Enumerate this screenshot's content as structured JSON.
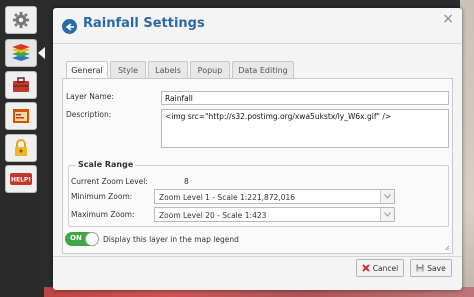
{
  "toolbar": {
    "tools": [
      {
        "icon": "gear-icon"
      },
      {
        "icon": "layers-icon"
      },
      {
        "icon": "toolbox-icon"
      },
      {
        "icon": "map-window-icon"
      },
      {
        "icon": "lock-icon"
      },
      {
        "icon": "help-icon",
        "label": "HELP!"
      }
    ]
  },
  "panel": {
    "title": "Rainfall Settings",
    "tabs": [
      "General",
      "Style",
      "Labels",
      "Popup",
      "Data Editing"
    ],
    "layer_name_label": "Layer Name:",
    "layer_name_value": "Rainfall",
    "description_label": "Description:",
    "description_value": "<img src=\"http://s32.postimg.org/xwa5ukstx/ly_W6x.gif\" />",
    "scale_range": {
      "legend": "Scale Range",
      "current_zoom_label": "Current Zoom Level:",
      "current_zoom_value": "8",
      "min_zoom_label": "Minimum Zoom:",
      "min_zoom_value": "Zoom Level 1 - Scale 1:221,872,016",
      "max_zoom_label": "Maximum Zoom:",
      "max_zoom_value": "Zoom Level 20 - Scale 1:423"
    },
    "legend_toggle": {
      "state": "ON",
      "label": "Display this layer in the map legend"
    },
    "cancel_label": "Cancel",
    "save_label": "Save"
  },
  "colors": {
    "accent": "#2b6aa8",
    "toggle_on": "#3ea644",
    "cancel_x": "#cc2222"
  }
}
